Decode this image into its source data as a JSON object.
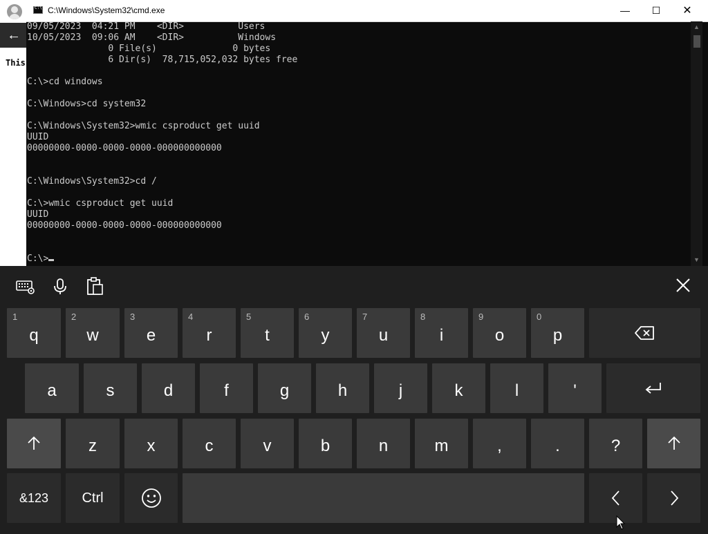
{
  "background_window": {
    "label": "This"
  },
  "window": {
    "title": "C:\\Windows\\System32\\cmd.exe",
    "controls": {
      "minimize": "—",
      "maximize": "☐",
      "close": "✕"
    }
  },
  "console": {
    "lines": [
      "09/05/2023  04:21 PM    <DIR>          Users",
      "10/05/2023  09:06 AM    <DIR>          Windows",
      "               0 File(s)              0 bytes",
      "               6 Dir(s)  78,715,052,032 bytes free",
      "",
      "C:\\>cd windows",
      "",
      "C:\\Windows>cd system32",
      "",
      "C:\\Windows\\System32>wmic csproduct get uuid",
      "UUID",
      "00000000-0000-0000-0000-000000000000",
      "",
      "",
      "C:\\Windows\\System32>cd /",
      "",
      "C:\\>wmic csproduct get uuid",
      "UUID",
      "00000000-0000-0000-0000-000000000000",
      "",
      ""
    ],
    "prompt": "C:\\>"
  },
  "keyboard": {
    "toolbar": [
      "keyboard-settings-icon",
      "microphone-icon",
      "clipboard-icon"
    ],
    "rows": [
      [
        {
          "id": "q",
          "label": "q",
          "hint": "1"
        },
        {
          "id": "w",
          "label": "w",
          "hint": "2"
        },
        {
          "id": "e",
          "label": "e",
          "hint": "3"
        },
        {
          "id": "r",
          "label": "r",
          "hint": "4"
        },
        {
          "id": "t",
          "label": "t",
          "hint": "5"
        },
        {
          "id": "y",
          "label": "y",
          "hint": "6"
        },
        {
          "id": "u",
          "label": "u",
          "hint": "7"
        },
        {
          "id": "i",
          "label": "i",
          "hint": "8"
        },
        {
          "id": "o",
          "label": "o",
          "hint": "9"
        },
        {
          "id": "p",
          "label": "p",
          "hint": "0"
        },
        {
          "id": "backspace",
          "icon": "backspace-icon"
        }
      ],
      [
        {
          "id": "a",
          "label": "a"
        },
        {
          "id": "s",
          "label": "s"
        },
        {
          "id": "d",
          "label": "d"
        },
        {
          "id": "f",
          "label": "f"
        },
        {
          "id": "g",
          "label": "g"
        },
        {
          "id": "h",
          "label": "h"
        },
        {
          "id": "j",
          "label": "j"
        },
        {
          "id": "k",
          "label": "k"
        },
        {
          "id": "l",
          "label": "l"
        },
        {
          "id": "apostrophe",
          "label": "'"
        },
        {
          "id": "enter",
          "icon": "enter-icon"
        }
      ],
      [
        {
          "id": "shift-left",
          "icon": "shift-icon"
        },
        {
          "id": "z",
          "label": "z"
        },
        {
          "id": "x",
          "label": "x"
        },
        {
          "id": "c",
          "label": "c"
        },
        {
          "id": "v",
          "label": "v"
        },
        {
          "id": "b",
          "label": "b"
        },
        {
          "id": "n",
          "label": "n"
        },
        {
          "id": "m",
          "label": "m"
        },
        {
          "id": "comma",
          "label": ","
        },
        {
          "id": "period",
          "label": "."
        },
        {
          "id": "question",
          "label": "?"
        },
        {
          "id": "shift-right",
          "icon": "shift-icon"
        }
      ],
      [
        {
          "id": "symbols",
          "label": "&123"
        },
        {
          "id": "ctrl",
          "label": "Ctrl"
        },
        {
          "id": "emoji",
          "icon": "emoji-icon"
        },
        {
          "id": "space",
          "label": ""
        },
        {
          "id": "arrow-left",
          "icon": "chevron-left-icon"
        },
        {
          "id": "arrow-right",
          "icon": "chevron-right-icon"
        }
      ]
    ]
  }
}
